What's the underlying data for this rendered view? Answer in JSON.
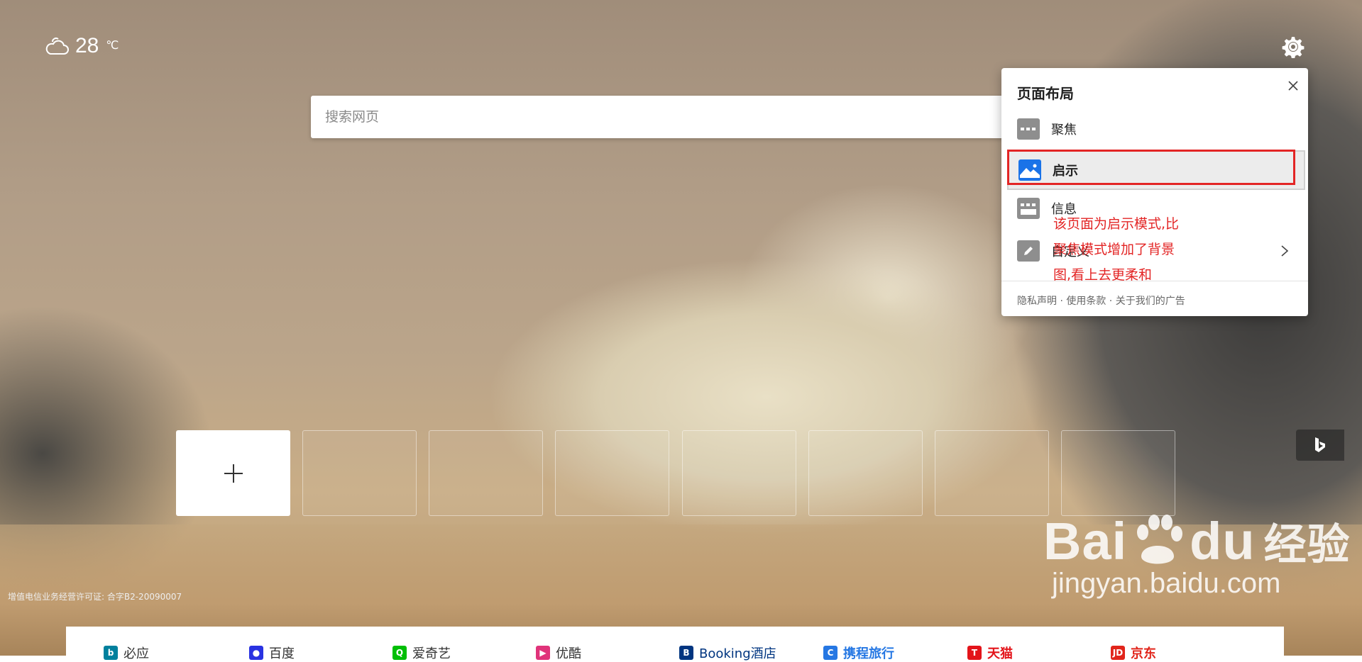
{
  "weather": {
    "temp": "28",
    "unit": "℃",
    "icon": "cloud-icon"
  },
  "search": {
    "placeholder": "搜索网页"
  },
  "panel": {
    "title": "页面布局",
    "options": [
      {
        "label": "聚焦",
        "icon": "focus-layout-icon"
      },
      {
        "label": "启示",
        "icon": "inspiration-layout-icon",
        "selected": true
      },
      {
        "label": "信息",
        "icon": "info-layout-icon"
      },
      {
        "label": "自定义",
        "icon": "edit-icon"
      }
    ],
    "footer": "隐私声明 · 使用条款 · 关于我们的广告"
  },
  "annotation": {
    "lines": [
      "该页面为启示模式,比",
      "聚焦模式增加了背景",
      "图,看上去更柔和"
    ],
    "color": "#e32525"
  },
  "license": "增值电信业务经营许可证: 合字B2-20090007",
  "watermark": {
    "brand_left": "Bai",
    "brand_right": "du",
    "brand_cn": "经验",
    "url": "jingyan.baidu.com"
  },
  "quicklinks": [
    {
      "label": "必应",
      "color": "#00809d"
    },
    {
      "label": "百度",
      "color": "#2932e1"
    },
    {
      "label": "爱奇艺",
      "color": "#00be06"
    },
    {
      "label": "优酷",
      "color": "#e0337a"
    },
    {
      "label": "Booking酒店",
      "color": "#003580"
    },
    {
      "label": "携程旅行",
      "color": "#2577e3"
    },
    {
      "label": "天猫",
      "color": "#e3141a"
    },
    {
      "label": "京东",
      "color": "#e1251b"
    }
  ],
  "colors": {
    "accent": "#1a73e8",
    "annotation": "#e32525"
  }
}
